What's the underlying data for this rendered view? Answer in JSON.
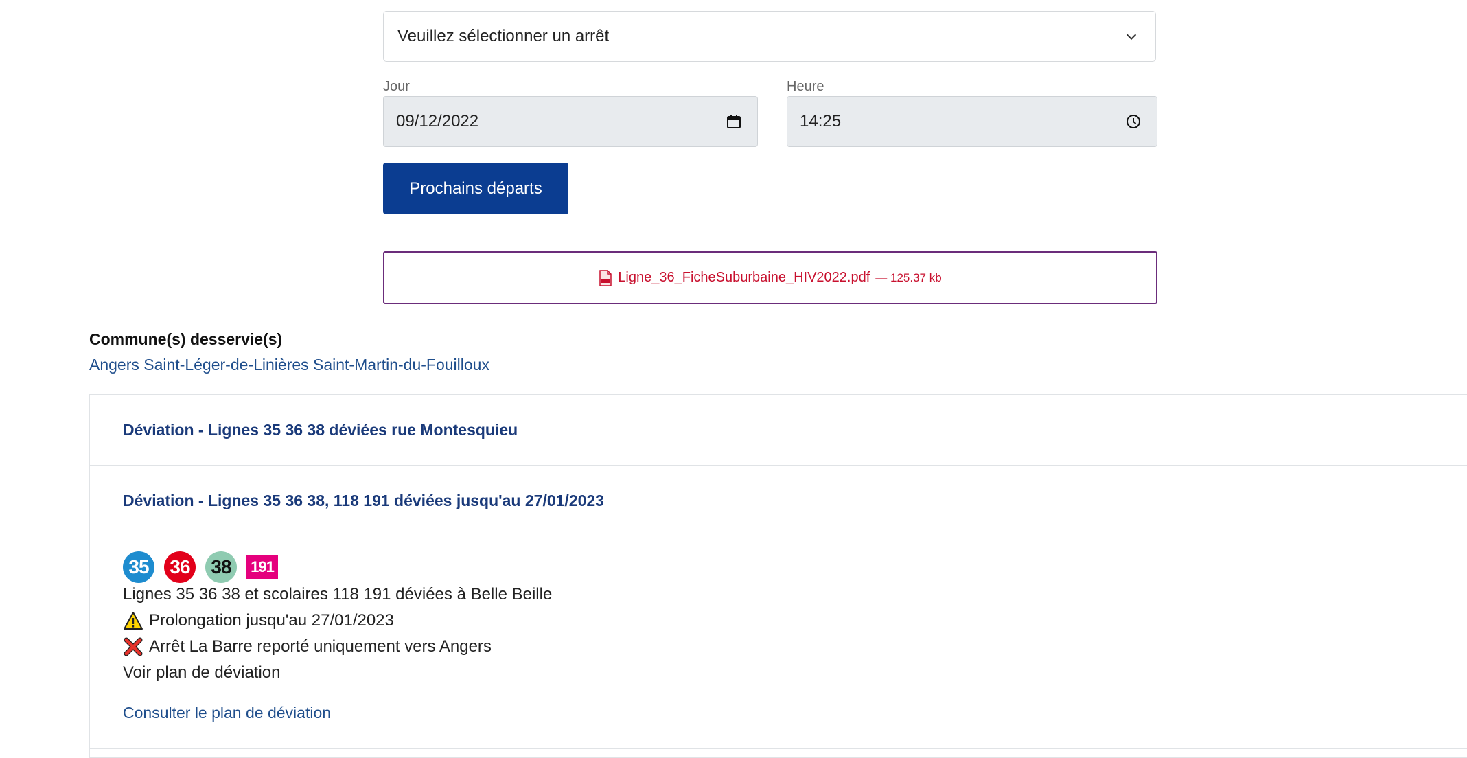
{
  "stop_select": {
    "placeholder": "Veuillez sélectionner un arrêt"
  },
  "date_field": {
    "label": "Jour",
    "value": "09/12/2022"
  },
  "time_field": {
    "label": "Heure",
    "value": "14:25"
  },
  "search_button": {
    "label": "Prochains départs"
  },
  "pdf": {
    "filename": "Ligne_36_FicheSuburbaine_HIV2022.pdf",
    "size": "— 125.37 kb"
  },
  "communes": {
    "title": "Commune(s) desservie(s)",
    "list": "Angers Saint-Léger-de-Linières Saint-Martin-du-Fouilloux"
  },
  "alerts": [
    {
      "title": "Déviation - Lignes 35 36 38 déviées rue Montesquieu",
      "expanded": false
    },
    {
      "title": "Déviation - Lignes 35 36 38, 118 191 déviées jusqu'au 27/01/2023",
      "expanded": true,
      "badges": [
        {
          "label": "35",
          "shape": "circle",
          "bg": "#1e8ccf",
          "fg": "#ffffff"
        },
        {
          "label": "36",
          "shape": "circle",
          "bg": "#e2001a",
          "fg": "#ffffff"
        },
        {
          "label": "38",
          "shape": "circle",
          "bg": "#8fcbb1",
          "fg": "#111111"
        },
        {
          "label": "191",
          "shape": "square",
          "bg": "#e5007d",
          "fg": "#ffffff"
        }
      ],
      "lines": [
        "Lignes 35 36 38 et scolaires 118 191 déviées à Belle Beille",
        "Prolongation jusqu'au 27/01/2023",
        "Arrêt La Barre reporté uniquement vers Angers",
        "Voir plan de déviation"
      ],
      "link": "Consulter le plan de déviation"
    }
  ],
  "colors": {
    "primary": "#0b3d91",
    "link": "#1f4e8c",
    "pdf": "#c8102e",
    "pdf_border": "#6b2d7b"
  },
  "icons": {
    "select": "chevron-down-icon",
    "date": "calendar-icon",
    "time": "clock-icon",
    "pdf": "pdf-file-icon",
    "warning": "warning-icon",
    "cancel": "cross-icon"
  }
}
